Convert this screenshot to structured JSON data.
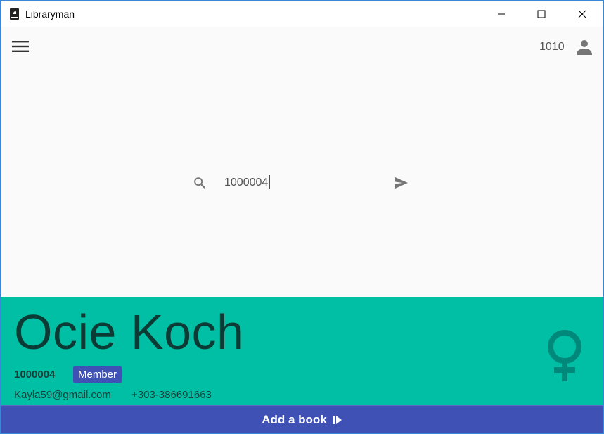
{
  "window": {
    "title": "Libraryman"
  },
  "appbar": {
    "menu_icon": "menu-icon",
    "user_number": "1010",
    "user_icon": "account-icon"
  },
  "search": {
    "value": "1000004",
    "search_icon": "search-icon",
    "send_icon": "send-icon"
  },
  "member": {
    "name": "Ocie Koch",
    "id": "1000004",
    "role": "Member",
    "email": "Kayla59@gmail.com",
    "phone": "+303-386691663",
    "gender_icon": "female-icon"
  },
  "actions": {
    "add_book_label": "Add a book",
    "add_book_icon": "play-arrow-icon"
  },
  "colors": {
    "panel": "#00bfa5",
    "accent": "#3f51b5",
    "name_text": "#0b3b34",
    "gender_icon": "#00897b"
  }
}
